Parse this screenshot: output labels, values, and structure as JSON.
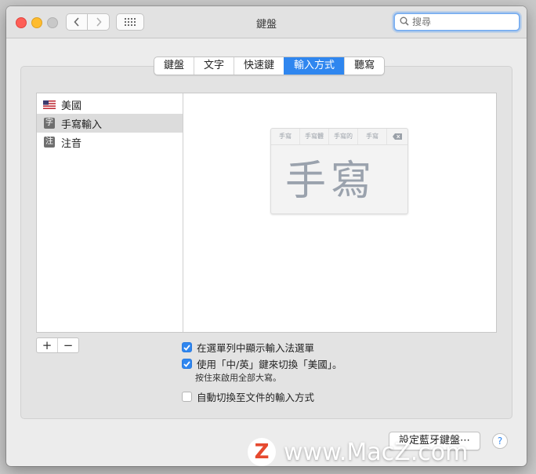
{
  "window": {
    "title": "鍵盤"
  },
  "search": {
    "placeholder": "搜尋"
  },
  "tabs": [
    {
      "label": "鍵盤"
    },
    {
      "label": "文字"
    },
    {
      "label": "快速鍵"
    },
    {
      "label": "輸入方式",
      "active": true
    },
    {
      "label": "聽寫"
    }
  ],
  "input_sources": [
    {
      "label": "美國",
      "icon": "us-flag-icon"
    },
    {
      "label": "手寫輸入",
      "icon": "handwriting-icon",
      "icon_char": "字",
      "selected": true
    },
    {
      "label": "注音",
      "icon": "zhuyin-icon",
      "icon_char": "注"
    }
  ],
  "preview": {
    "candidates": [
      "手寫",
      "手寫體",
      "手寫的",
      "手寫"
    ],
    "handwriting": "手寫"
  },
  "options": {
    "show_menu": {
      "label": "在選單列中顯示輸入法選單",
      "checked": true
    },
    "caps_switch": {
      "label": "使用「中/英」鍵來切換「美國」。",
      "checked": true
    },
    "caps_hint": "按住來啟用全部大寫。",
    "auto_switch": {
      "label": "自動切換至文件的輸入方式",
      "checked": false
    }
  },
  "buttons": {
    "add": "+",
    "remove": "−",
    "bluetooth": "設定藍牙鍵盤⋯",
    "help": "?"
  },
  "watermark": {
    "logo": "Z",
    "text": "www.MacZ.com"
  },
  "colors": {
    "accent": "#2f86ef",
    "close": "#fe5f57",
    "minimize": "#febc2e"
  }
}
